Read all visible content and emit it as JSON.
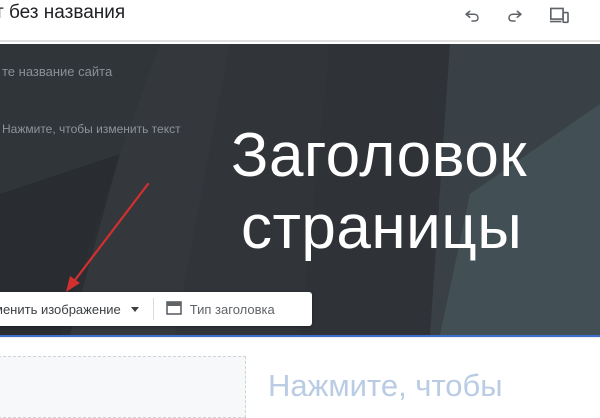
{
  "topbar": {
    "site_title": "т без названия",
    "undo_icon": "undo-icon",
    "redo_icon": "redo-icon",
    "preview_icon": "devices-preview-icon"
  },
  "header": {
    "site_name_placeholder": "те название сайта",
    "text_placeholder": "Нажмите, чтобы изменить текст",
    "title_line1": "Заголовок",
    "title_line2": "страницы",
    "background_color": "#2f3338",
    "accent_border": "#3d6fcf"
  },
  "image_toolbar": {
    "change_image_label": "менить изображение",
    "header_type_label": "Тип заголовка",
    "header_type_icon": "header-layout-icon"
  },
  "annotation": {
    "arrow_color": "#d32f2f"
  },
  "content": {
    "body_text": "Нажмите, чтобы"
  }
}
